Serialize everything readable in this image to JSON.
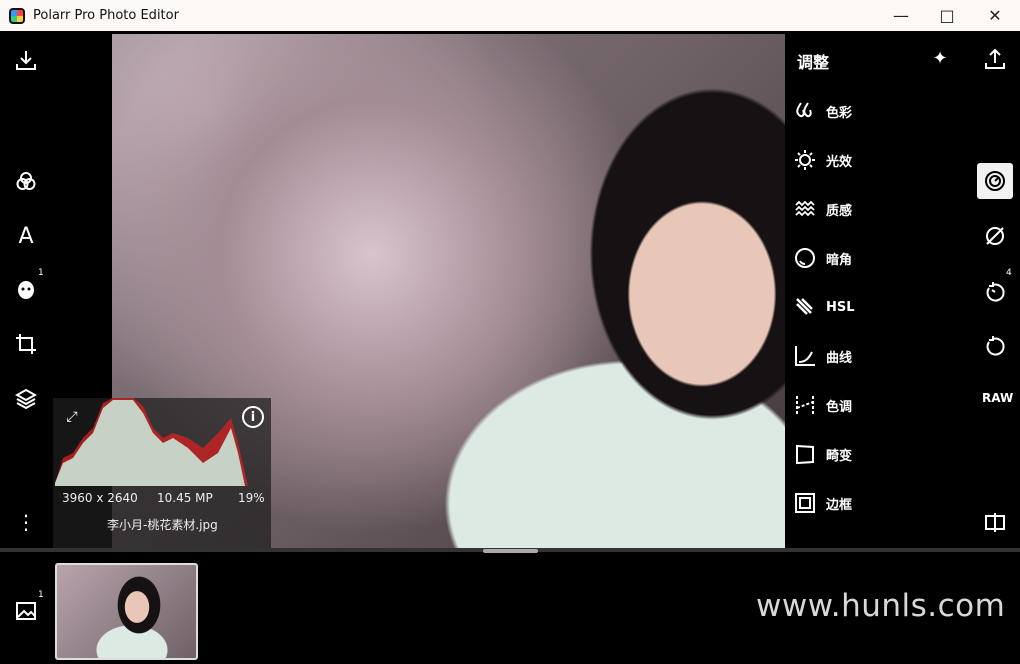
{
  "app": {
    "title": "Polarr Pro Photo Editor"
  },
  "right_panel": {
    "title": "调整",
    "items": [
      {
        "label": "色彩",
        "icon": "drops-icon"
      },
      {
        "label": "光效",
        "icon": "sun-icon"
      },
      {
        "label": "质感",
        "icon": "waves-icon"
      },
      {
        "label": "暗角",
        "icon": "vignette-icon"
      },
      {
        "label": "HSL",
        "icon": "hsl-icon"
      },
      {
        "label": "曲线",
        "icon": "curve-icon"
      },
      {
        "label": "色调",
        "icon": "toning-icon"
      },
      {
        "label": "畸变",
        "icon": "distortion-icon"
      },
      {
        "label": "边框",
        "icon": "border-icon"
      }
    ],
    "raw_label": "RAW",
    "history_badge": "4"
  },
  "left_toolbar": {
    "face_badge": "1",
    "gallery_badge": "1"
  },
  "histogram": {
    "dimensions": "3960 x 2640",
    "megapixels": "10.45 MP",
    "zoom": "19%",
    "filename": "李小月-桃花素材.jpg"
  },
  "watermark": "www.hunls.com"
}
